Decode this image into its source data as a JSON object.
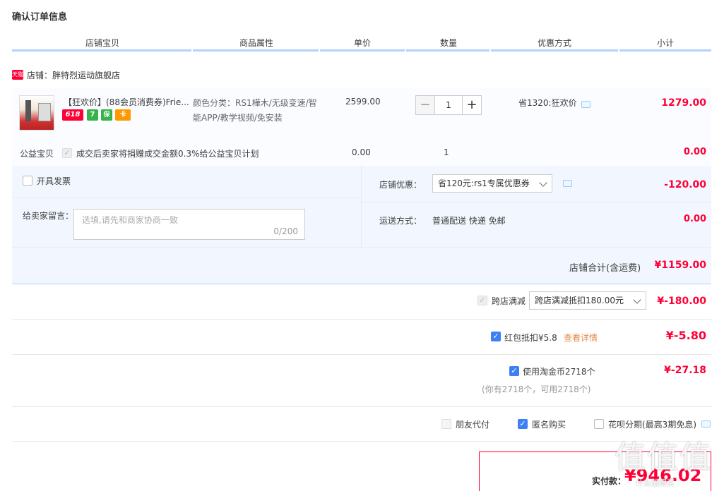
{
  "page_title": "确认订单信息",
  "columns": [
    "店铺宝贝",
    "商品属性",
    "单价",
    "数量",
    "优惠方式",
    "小计"
  ],
  "shop": {
    "badge": "天猫",
    "label": "店铺：",
    "name": "胖特烈运动旗舰店"
  },
  "item": {
    "title": "【狂欢价】(88会员消费券)Friendly",
    "title_display": "【狂欢价】(88会员消费券)Frie...",
    "badges": [
      {
        "text": "618",
        "color": "#ff0036"
      },
      {
        "text": "7",
        "color": "#36b34a"
      },
      {
        "text": "保",
        "color": "#36b34a"
      },
      {
        "text": "卡",
        "color": "#ff9900"
      }
    ],
    "attributes": "颜色分类：RS1樺木/无级变速/智能APP/教学视频/免安装",
    "unit_price": "2599.00",
    "quantity": "1",
    "discount": "省1320:狂欢价",
    "subtotal": "1279.00"
  },
  "charity": {
    "label": "公益宝贝",
    "text": "成交后卖家将捐赠成交金额0.3%给公益宝贝计划",
    "price": "0.00",
    "quantity": "1",
    "subtotal": "0.00"
  },
  "invoice": {
    "label": "开具发票"
  },
  "message": {
    "label": "给卖家留言：",
    "placeholder": "选填,请先和商家协商一致",
    "counter": "0/200"
  },
  "shop_discount": {
    "label": "店铺优惠：",
    "selected": "省120元:rs1专属优惠券",
    "amount": "-120.00"
  },
  "shipping": {
    "label": "运送方式：",
    "method": "普通配送 快递 免邮",
    "amount": "0.00"
  },
  "shop_total": {
    "label": "店铺合计(含运费)",
    "amount": "¥1159.00"
  },
  "cross_store": {
    "label": "跨店满减",
    "selected": "跨店满减抵扣180.00元",
    "amount": "¥-180.00"
  },
  "red_packet": {
    "label": "红包抵扣¥5.8",
    "link": "查看详情",
    "amount": "¥-5.80"
  },
  "taojinbi": {
    "label": "使用淘金币2718个",
    "note": "(你有2718个，可用2718个)",
    "amount": "¥-27.18"
  },
  "options": {
    "friend_pay": "朋友代付",
    "anonymous": "匿名购买",
    "huabei": "花呗分期(最高3期免息)"
  },
  "payment": {
    "label": "实付款：",
    "amount": "¥946.02"
  },
  "watermark": "值 值 值",
  "watermark_sub": "什么值得买",
  "colors": {
    "accent_red": "#ff0036",
    "header_line": "#b2d1ff",
    "panel_bg": "#f2f7ff",
    "check_blue": "#3d7ff5"
  },
  "icons": [
    "tmall-icon",
    "chat-icon",
    "chevron-down-icon",
    "check-icon",
    "minus-icon",
    "plus-icon"
  ]
}
